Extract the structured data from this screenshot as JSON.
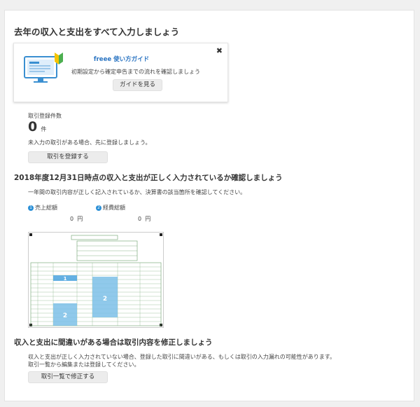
{
  "page": {
    "title": "去年の収入と支出をすべて入力しましょう"
  },
  "guide": {
    "title": "freee 使い方ガイド",
    "description": "初期設定から確定申告までの流れを確認しましょう",
    "button": "ガイドを見る",
    "close": "✖"
  },
  "transactions": {
    "label": "取引登録件数",
    "count": "0",
    "unit": "件",
    "note": "未入力の取引がある場合、先に登録しましょう。",
    "button": "取引を登録する"
  },
  "check": {
    "title": "2018年度12月31日時点の収入と支出が正しく入力されているか確認しましょう",
    "description": "一年間の取引内容が正しく記入されているか、決算書の該当箇所を確認してください。",
    "sales": {
      "badge": "1",
      "label": "売上総額",
      "value": "0",
      "unit": "円"
    },
    "expenses": {
      "badge": "2",
      "label": "経費総額",
      "value": "0",
      "unit": "円"
    },
    "form_numbers": [
      "1",
      "2",
      "2"
    ]
  },
  "fix": {
    "title": "収入と支出に間違いがある場合は取引内容を修正しましょう",
    "line1": "収入と支出が正しく入力されていない場合、登録した取引に間違いがある、もしくは取引の入力漏れの可能性があります。",
    "line2": "取引一覧から編集または登録してください。",
    "button": "取引一覧で修正する"
  }
}
